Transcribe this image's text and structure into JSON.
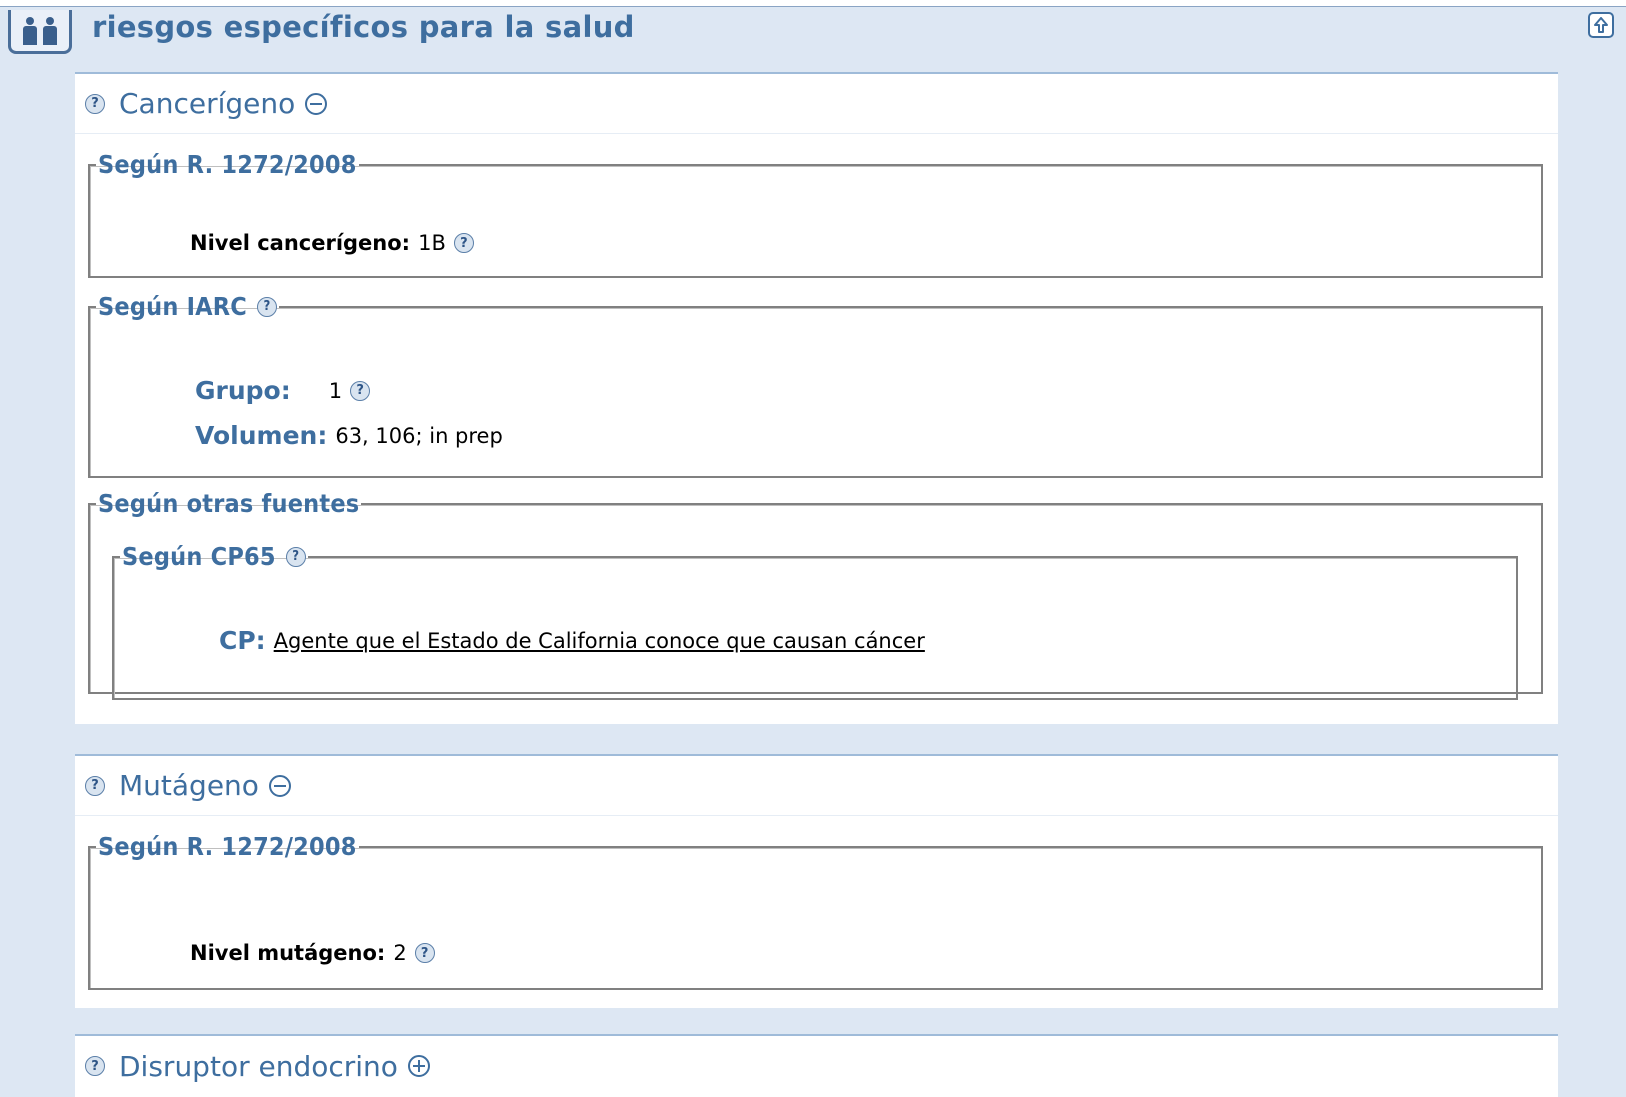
{
  "header": {
    "title": "riesgos específicos para la salud",
    "icon": "people-icon",
    "up_icon": "arrow-up-icon"
  },
  "help_glyph": "?",
  "cancerigeno": {
    "title": "Cancerígeno",
    "r1272": {
      "legend": "Según R. 1272/2008",
      "label": "Nivel cancerígeno:",
      "value": "1B"
    },
    "iarc": {
      "legend": "Según IARC",
      "grupo_label": "Grupo:",
      "grupo_value": "1",
      "volumen_label": "Volumen:",
      "volumen_value": "63, 106; in prep"
    },
    "otras": {
      "legend": "Según otras fuentes",
      "cp65": {
        "legend": "Según CP65",
        "label": "CP:",
        "link": "Agente que el Estado de California conoce que causan cáncer"
      }
    }
  },
  "mutageno": {
    "title": "Mutágeno",
    "r1272": {
      "legend": "Según R. 1272/2008",
      "label": "Nivel mutágeno:",
      "value": "2"
    }
  },
  "disruptor": {
    "title": "Disruptor endocrino"
  },
  "colors": {
    "background": "#dde7f3",
    "accent": "#3e6e9f",
    "border": "#808080"
  }
}
